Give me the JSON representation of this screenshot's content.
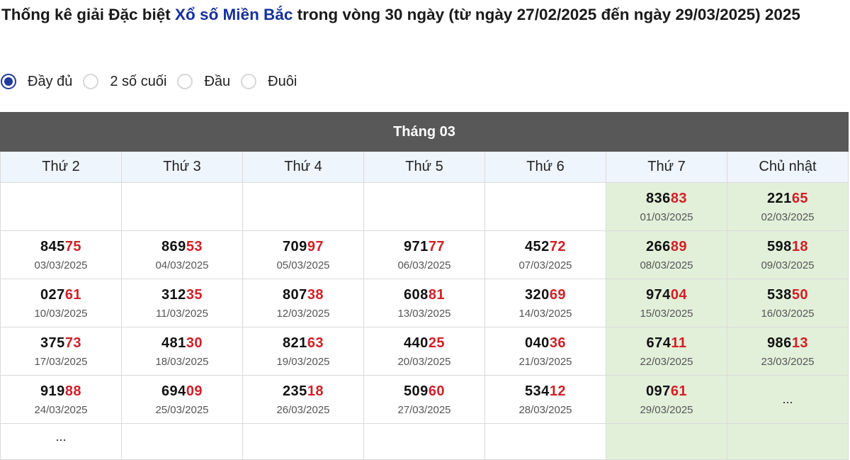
{
  "header": {
    "title_prefix": "Thống kê giải Đặc biệt ",
    "title_link": "Xổ số Miền Bắc",
    "title_suffix": " trong vòng 30 ngày (từ ngày 27/02/2025 đến ngày 29/03/2025) 2025"
  },
  "filters": [
    {
      "label": "Đầy đủ",
      "checked": true
    },
    {
      "label": "2 số cuối",
      "checked": false
    },
    {
      "label": "Đầu",
      "checked": false
    },
    {
      "label": "Đuôi",
      "checked": false
    }
  ],
  "calendar": {
    "month_label": "Tháng 03",
    "weekdays": [
      "Thứ 2",
      "Thứ 3",
      "Thứ 4",
      "Thứ 5",
      "Thứ 6",
      "Thứ 7",
      "Chủ nhật"
    ],
    "colors": {
      "tail": "#d21f26",
      "weekend_bg": "#e2f0da",
      "header_bg": "#585858",
      "link": "#16309c"
    },
    "weeks": [
      [
        null,
        null,
        null,
        null,
        null,
        {
          "head": "836",
          "tail": "83",
          "date": "01/03/2025"
        },
        {
          "head": "221",
          "tail": "65",
          "date": "02/03/2025"
        }
      ],
      [
        {
          "head": "845",
          "tail": "75",
          "date": "03/03/2025"
        },
        {
          "head": "869",
          "tail": "53",
          "date": "04/03/2025"
        },
        {
          "head": "709",
          "tail": "97",
          "date": "05/03/2025"
        },
        {
          "head": "971",
          "tail": "77",
          "date": "06/03/2025"
        },
        {
          "head": "452",
          "tail": "72",
          "date": "07/03/2025"
        },
        {
          "head": "266",
          "tail": "89",
          "date": "08/03/2025"
        },
        {
          "head": "598",
          "tail": "18",
          "date": "09/03/2025"
        }
      ],
      [
        {
          "head": "027",
          "tail": "61",
          "date": "10/03/2025"
        },
        {
          "head": "312",
          "tail": "35",
          "date": "11/03/2025"
        },
        {
          "head": "807",
          "tail": "38",
          "date": "12/03/2025"
        },
        {
          "head": "608",
          "tail": "81",
          "date": "13/03/2025"
        },
        {
          "head": "320",
          "tail": "69",
          "date": "14/03/2025"
        },
        {
          "head": "974",
          "tail": "04",
          "date": "15/03/2025"
        },
        {
          "head": "538",
          "tail": "50",
          "date": "16/03/2025"
        }
      ],
      [
        {
          "head": "375",
          "tail": "73",
          "date": "17/03/2025"
        },
        {
          "head": "481",
          "tail": "30",
          "date": "18/03/2025"
        },
        {
          "head": "821",
          "tail": "63",
          "date": "19/03/2025"
        },
        {
          "head": "440",
          "tail": "25",
          "date": "20/03/2025"
        },
        {
          "head": "040",
          "tail": "36",
          "date": "21/03/2025"
        },
        {
          "head": "674",
          "tail": "11",
          "date": "22/03/2025"
        },
        {
          "head": "986",
          "tail": "13",
          "date": "23/03/2025"
        }
      ],
      [
        {
          "head": "919",
          "tail": "88",
          "date": "24/03/2025"
        },
        {
          "head": "694",
          "tail": "09",
          "date": "25/03/2025"
        },
        {
          "head": "235",
          "tail": "18",
          "date": "26/03/2025"
        },
        {
          "head": "509",
          "tail": "60",
          "date": "27/03/2025"
        },
        {
          "head": "534",
          "tail": "12",
          "date": "28/03/2025"
        },
        {
          "head": "097",
          "tail": "61",
          "date": "29/03/2025"
        },
        {
          "pending": "..."
        }
      ],
      [
        {
          "pending": "..."
        },
        null,
        null,
        null,
        null,
        null,
        null
      ]
    ]
  }
}
